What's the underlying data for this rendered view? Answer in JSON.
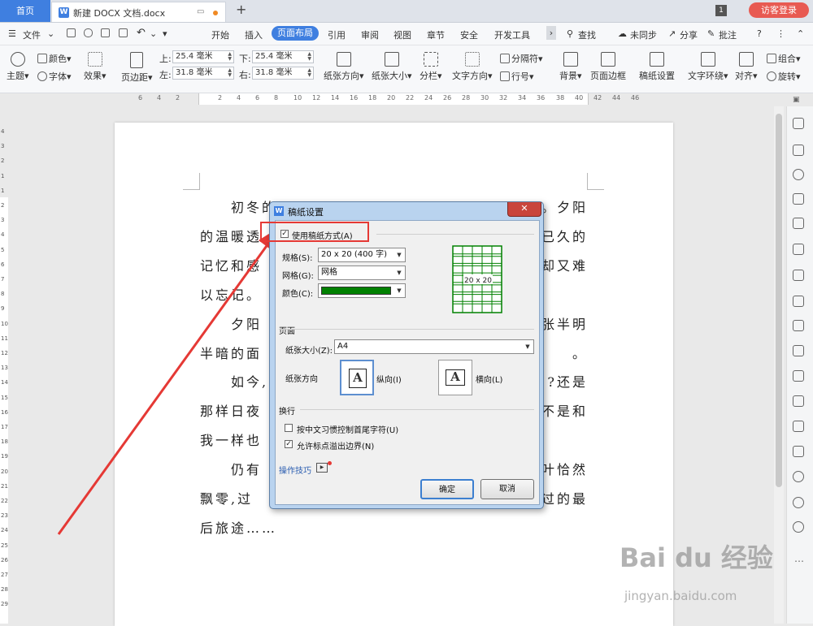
{
  "tabbar": {
    "home": "首页",
    "doc_title": "新建 DOCX 文档.docx",
    "page_count": "1",
    "login": "访客登录"
  },
  "menu": {
    "file": "文件",
    "tabs": [
      "开始",
      "插入",
      "页面布局",
      "引用",
      "审阅",
      "视图",
      "章节",
      "安全",
      "开发工具"
    ],
    "search": "查找",
    "sync": "未同步",
    "share": "分享",
    "comment": "批注",
    "help": "?"
  },
  "ribbon": {
    "theme": "主题",
    "color": "颜色",
    "font": "字体",
    "effect": "效果",
    "margin": "页边距",
    "top_label": "上:",
    "top_value": "25.4 毫米",
    "bottom_label": "下:",
    "bottom_value": "25.4 毫米",
    "left_label": "左:",
    "left_value": "31.8 毫米",
    "right_label": "右:",
    "right_value": "31.8 毫米",
    "orientation": "纸张方向",
    "paper_size": "纸张大小",
    "columns": "分栏",
    "text_direction": "文字方向",
    "separator": "分隔符",
    "line_numbers": "行号",
    "background": "背景",
    "page_border": "页面边框",
    "manuscript": "稿纸设置",
    "text_wrap": "文字环绕",
    "align": "对齐",
    "group": "组合",
    "rotate": "旋转"
  },
  "ruler": {
    "numbers": [
      "6",
      "4",
      "2",
      "2",
      "4",
      "6",
      "8",
      "10",
      "12",
      "14",
      "16",
      "18",
      "20",
      "22",
      "24",
      "26",
      "28",
      "30",
      "32",
      "34",
      "36",
      "38",
      "40",
      "42",
      "44",
      "46"
    ]
  },
  "vruler": {
    "numbers": [
      "4",
      "3",
      "2",
      "1",
      "1",
      "2",
      "3",
      "4",
      "5",
      "6",
      "7",
      "8",
      "9",
      "10",
      "11",
      "12",
      "13",
      "14",
      "15",
      "16",
      "17",
      "18",
      "19",
      "20",
      "21",
      "22",
      "23",
      "24",
      "25",
      "26",
      "27",
      "28",
      "29"
    ]
  },
  "document": {
    "lines": [
      {
        "left": "　　初冬的",
        "right": "。夕阳"
      },
      {
        "left": "的温暖透",
        "right": "已久的"
      },
      {
        "left": "记忆和感",
        "right": "却又难"
      },
      {
        "left": "以忘记。",
        "right": ""
      },
      {
        "left": "　　夕阳",
        "right": "张半明"
      },
      {
        "left": "半暗的面",
        "right": "。"
      },
      {
        "left": "　　如今,",
        "right": "?还是"
      },
      {
        "left": "那样日夜",
        "right": "不是和"
      },
      {
        "left": "我一样也",
        "right": ""
      },
      {
        "left": "　　仍有",
        "right": "叶恰然"
      },
      {
        "left": "飘零,过",
        "right": "过的最"
      },
      {
        "left": "后旅途……",
        "right": ""
      }
    ]
  },
  "dialog": {
    "title": "稿纸设置",
    "use_manuscript": "使用稿纸方式(A)",
    "spec_label": "规格(S):",
    "spec_value": "20 x 20 (400 字)",
    "grid_label": "网格(G):",
    "grid_value": "网格",
    "color_label": "颜色(C):",
    "color_value": "#008000",
    "preview": "20 x 20",
    "page_section": "页面",
    "paper_size_label": "纸张大小(Z):",
    "paper_size_value": "A4",
    "orientation_label": "纸张方向",
    "portrait": "纵向(I)",
    "landscape": "横向(L)",
    "wrap_section": "换行",
    "chinese_control": "按中文习惯控制首尾字符(U)",
    "allow_punct": "允许标点溢出边界(N)",
    "chinese_control_checked": false,
    "allow_punct_checked": true,
    "tips": "操作技巧",
    "ok": "确定",
    "cancel": "取消"
  },
  "watermark": {
    "brand": "Bai du 经验",
    "url": "jingyan.baidu.com"
  },
  "colors": {
    "accent": "#3f7fe0",
    "annotation": "#e53935",
    "login": "#e85a52",
    "grid_green": "#008000"
  }
}
